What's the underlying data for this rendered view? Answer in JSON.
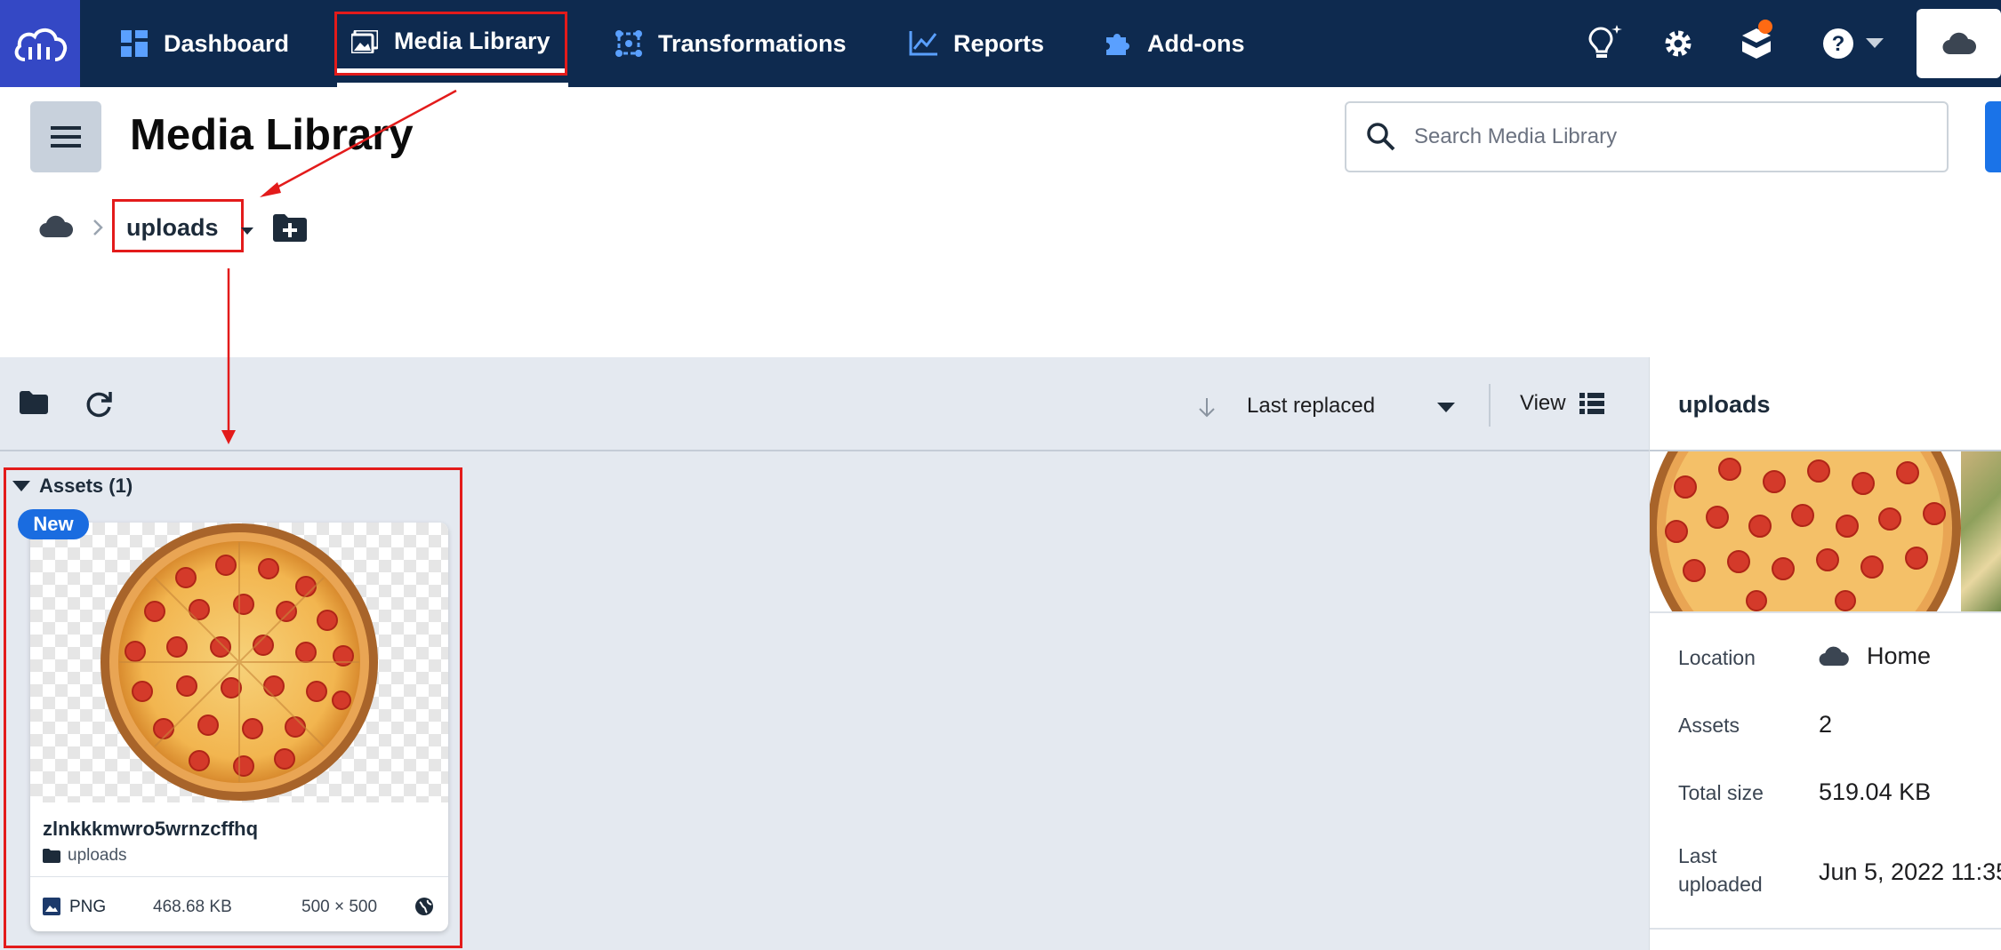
{
  "nav": {
    "items": [
      {
        "label": "Dashboard",
        "icon": "dashboard-grid-icon"
      },
      {
        "label": "Media Library",
        "icon": "media-library-icon"
      },
      {
        "label": "Transformations",
        "icon": "transformations-icon"
      },
      {
        "label": "Reports",
        "icon": "reports-chart-icon"
      },
      {
        "label": "Add-ons",
        "icon": "puzzle-icon"
      }
    ],
    "active": "Media Library",
    "notification_color": "#ff6a13",
    "brand_color": "#3448c5",
    "nav_color": "#0e2a4f"
  },
  "header": {
    "title": "Media Library",
    "search_placeholder": "Search Media Library"
  },
  "breadcrumb": {
    "current_folder": "uploads"
  },
  "toolbar": {
    "sort_label": "Last replaced",
    "view_label": "View"
  },
  "assets": {
    "section_label": "Assets (1)",
    "items": [
      {
        "badge": "New",
        "name": "zlnkkkmwro5wrnzcffhq",
        "folder": "uploads",
        "format": "PNG",
        "size": "468.68 KB",
        "dimensions": "500 × 500"
      }
    ]
  },
  "details_panel": {
    "title": "uploads",
    "location_label": "Location",
    "location_value": "Home",
    "assets_label": "Assets",
    "assets_value": "2",
    "total_size_label": "Total size",
    "total_size_value": "519.04 KB",
    "last_uploaded_label_1": "Last",
    "last_uploaded_label_2": "uploaded",
    "last_uploaded_value": "Jun 5, 2022 11:35"
  },
  "annotation_color": "#e31b1b"
}
